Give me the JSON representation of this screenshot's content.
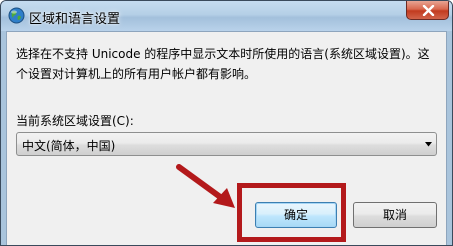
{
  "window": {
    "title": "区域和语言设置",
    "icon": "globe-icon"
  },
  "titlebar": {
    "close_icon": "close-icon"
  },
  "dialog": {
    "description": "选择在不支持 Unicode 的程序中显示文本时所使用的语言(系统区域设置)。这个设置对计算机上的所有用户帐户都有影响。",
    "locale_label": "当前系统区域设置(C):",
    "locale_value": "中文(简体，中国)",
    "ok_label": "确定",
    "cancel_label": "取消"
  },
  "annotation": {
    "highlight_color": "#b3191b",
    "arrow_color": "#b3191b"
  }
}
